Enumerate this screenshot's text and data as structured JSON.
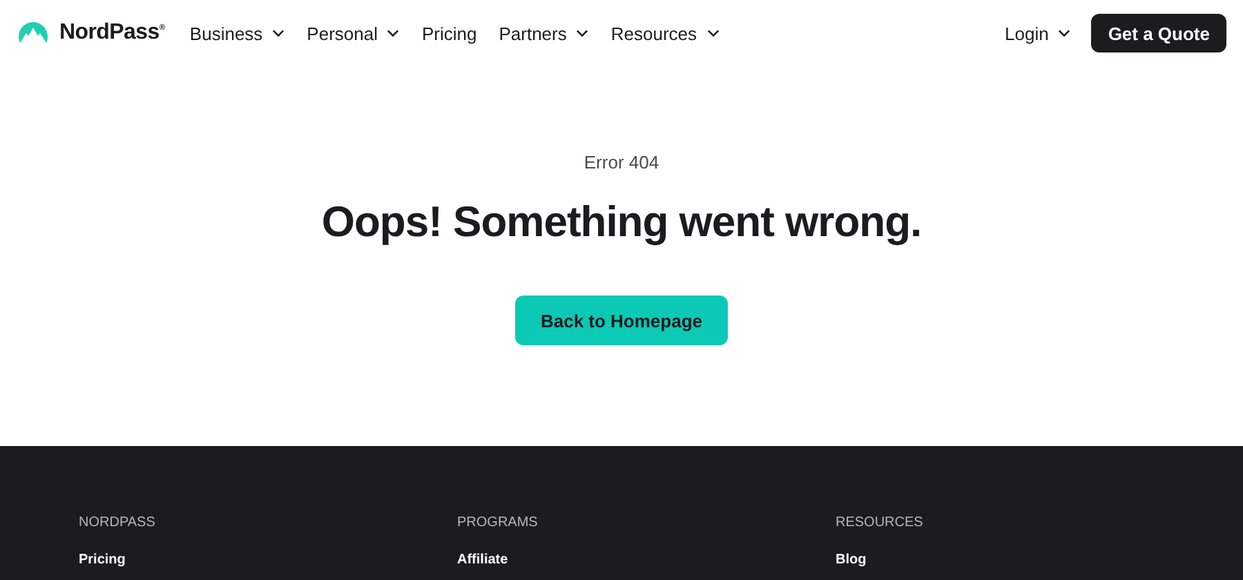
{
  "nav": {
    "brand": "NordPass$^{®}$",
    "items": [
      {
        "label": "Business",
        "dropdown": true
      },
      {
        "label": "Personal",
        "dropdown": true
      },
      {
        "label": "Pricing",
        "dropdown": false
      },
      {
        "label": "Partners",
        "dropdown": true
      },
      {
        "label": "Resources",
        "dropdown": true
      }
    ],
    "login": {
      "label": "Login",
      "dropdown": true
    },
    "cta": "Get a Quote"
  },
  "error": {
    "code": "Error 404",
    "heading": "Oops! Something went wrong.",
    "button": "Back to Homepage"
  },
  "footer": {
    "columns": [
      {
        "heading": "NORDPASS",
        "links": [
          "Pricing"
        ]
      },
      {
        "heading": "PROGRAMS",
        "links": [
          "Affiliate"
        ]
      },
      {
        "heading": "RESOURCES",
        "links": [
          "Blog"
        ]
      }
    ]
  }
}
